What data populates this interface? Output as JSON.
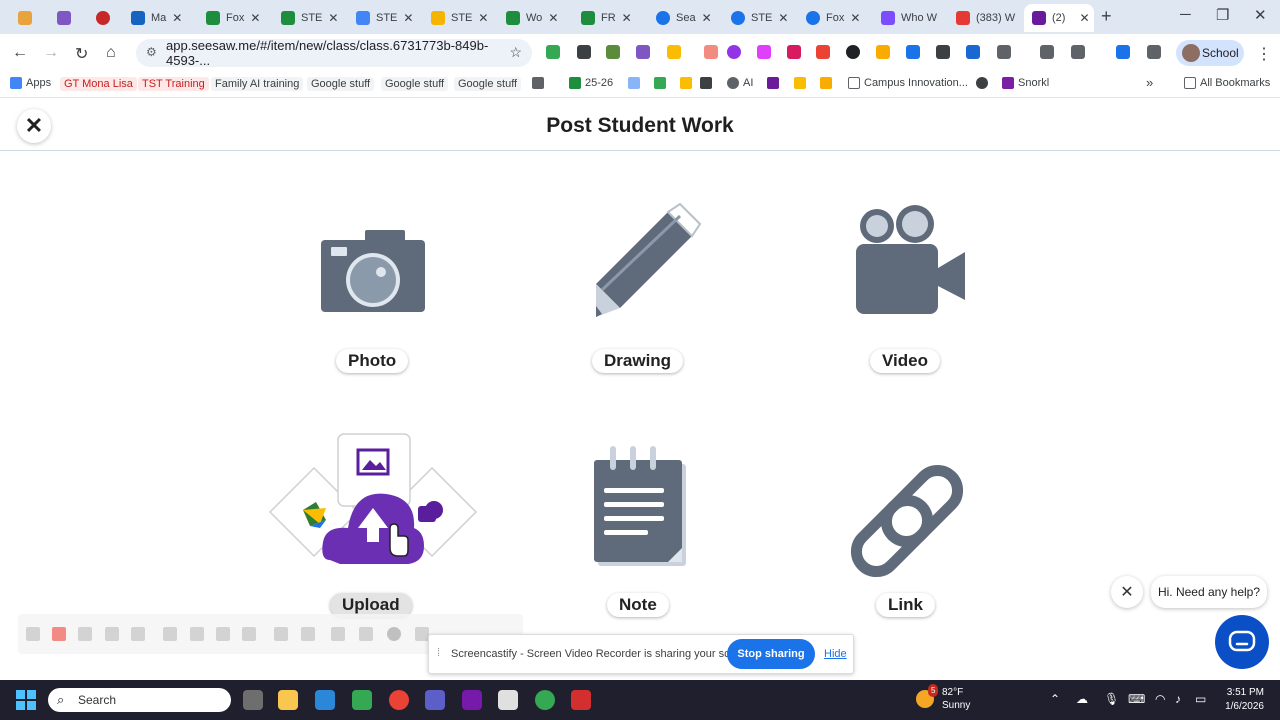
{
  "browser": {
    "tabs": [
      {
        "label": "",
        "color": "#e8a33d"
      },
      {
        "label": "",
        "color": "#7e57c2"
      },
      {
        "label": "",
        "color": "#c62828"
      },
      {
        "label": "Ma",
        "color": "#1565c0"
      },
      {
        "label": "Fox",
        "color": "#1e8e3e"
      },
      {
        "label": "STE",
        "color": "#1e8e3e"
      },
      {
        "label": "STE",
        "color": "#4285f4"
      },
      {
        "label": "STE",
        "color": "#f4b400"
      },
      {
        "label": "Wo",
        "color": "#1e8e3e"
      },
      {
        "label": "FR",
        "color": "#1e8e3e"
      },
      {
        "label": "Sea",
        "color": "#1a73e8"
      },
      {
        "label": "STE",
        "color": "#1a73e8"
      },
      {
        "label": "Fox",
        "color": "#1a73e8"
      },
      {
        "label": "Who W",
        "color": "#7c4dff"
      },
      {
        "label": "(383) W",
        "color": "#e53935"
      },
      {
        "label": "(2)",
        "color": "#6a1b9a"
      }
    ],
    "url": "app.seesaw.me/#/item/new/class/class.6731773b-849b-4593-...",
    "profile_label": "School",
    "bookmarks": [
      {
        "label": "Apps",
        "color": "#4285f4"
      },
      {
        "label": "GT Mona Lisa",
        "color": "#d93025",
        "pill": "#fde7e7"
      },
      {
        "label": "TST Training",
        "color": "#c5221f",
        "pill": "#fde7e7"
      },
      {
        "label": "Family AI training",
        "color": "#e8eaed",
        "pill": "#f1f3f4"
      },
      {
        "label": "Google stuff",
        "color": "#e8eaed",
        "pill": "#f1f3f4"
      },
      {
        "label": "Google stuff",
        "color": "#e8eaed",
        "pill": "#f1f3f4"
      },
      {
        "label": "Google stuff",
        "color": "#e8eaed",
        "pill": "#f1f3f4"
      },
      {
        "label": "",
        "color": "#5f6368"
      },
      {
        "label": "25-26",
        "color": "#1e8e3e"
      },
      {
        "label": "AI",
        "color": "#5f6368"
      },
      {
        "label": "Campus Innovation...",
        "color": "#5f6368"
      },
      {
        "label": "Snorkl",
        "color": "#7b1fa2"
      }
    ],
    "all_bookmarks": "All Bookmarks"
  },
  "page": {
    "title": "Post Student Work",
    "options": [
      {
        "label": "Photo"
      },
      {
        "label": "Drawing"
      },
      {
        "label": "Video"
      },
      {
        "label": "Upload"
      },
      {
        "label": "Note"
      },
      {
        "label": "Link"
      }
    ]
  },
  "share_banner": {
    "message": "Screencastify - Screen Video Recorder is sharing your screen.",
    "stop_label": "Stop sharing",
    "hide_label": "Hide"
  },
  "help": {
    "bubble": "Hi. Need any help?"
  },
  "taskbar": {
    "search_placeholder": "Search",
    "weather_badge": "5",
    "temperature": "82°F",
    "condition": "Sunny",
    "time": "3:51 PM",
    "date": "1/6/2026"
  },
  "colors": {
    "icon_gray": "#5f6b7a",
    "upload_purple": "#6b2fb3",
    "chat_blue": "#0a4fc6",
    "stop_blue": "#1a73e8"
  }
}
